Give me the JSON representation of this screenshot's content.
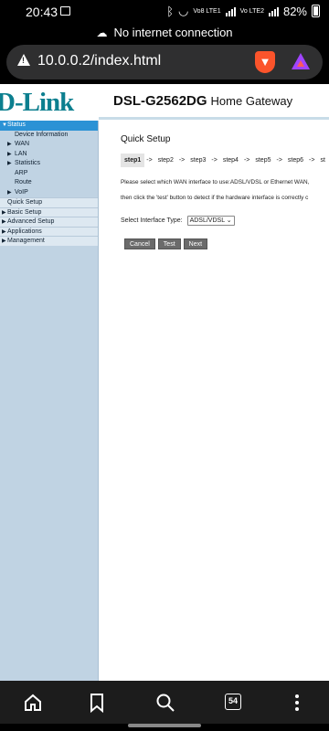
{
  "statusbar": {
    "time": "20:43",
    "battery": "82%",
    "network_label_1": "Vo8\nLTE1",
    "network_label_2": "Vo\nLTE2"
  },
  "notice": "No internet connection",
  "browser": {
    "url": "10.0.0.2/index.html",
    "tab_count": "54"
  },
  "router": {
    "logo": "D-Link",
    "model": "DSL-G2562DG",
    "subtitle": "Home Gateway"
  },
  "sidebar": {
    "items": [
      {
        "label": "Status"
      },
      {
        "label": "Device Information"
      },
      {
        "label": "WAN"
      },
      {
        "label": "LAN"
      },
      {
        "label": "Statistics"
      },
      {
        "label": "ARP"
      },
      {
        "label": "Route"
      },
      {
        "label": "VoIP"
      },
      {
        "label": "Quick Setup"
      },
      {
        "label": "Basic Setup"
      },
      {
        "label": "Advanced Setup"
      },
      {
        "label": "Applications"
      },
      {
        "label": "Management"
      }
    ]
  },
  "content": {
    "title": "Quick Setup",
    "steps": [
      "step1",
      "step2",
      "step3",
      "step4",
      "step5",
      "step6",
      "st"
    ],
    "arrow": "->",
    "message_1": "Please select which WAN interface to use:ADSL/VDSL or Ethernet WAN,",
    "message_2": "then click the 'test' button to detect if the hardware interface is correctly c",
    "interface_label": "Select Interface Type:",
    "interface_value": "ADSL/VDSL",
    "buttons": {
      "cancel": "Cancel",
      "test": "Test",
      "next": "Next"
    }
  },
  "colors": {
    "active_nav": "#2b92d5",
    "sidebar": "#c0d3e3",
    "button": "#6b6b6b",
    "brand": "#0c7f8f"
  }
}
